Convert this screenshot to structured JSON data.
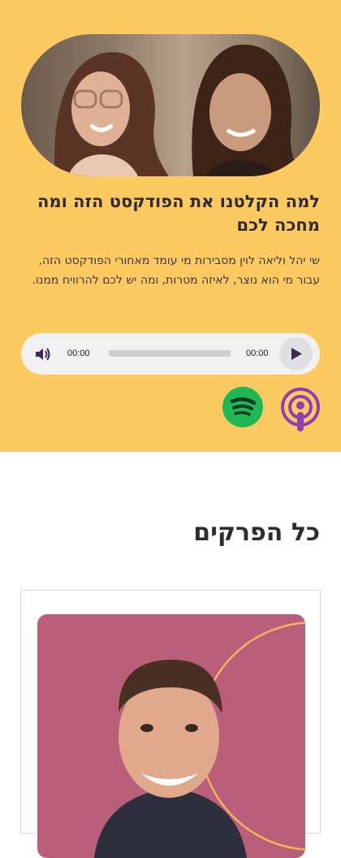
{
  "hero": {
    "title": "למה הקלטנו את הפודקסט הזה ומה מחכה לכם",
    "description": "שי יהל וליאה לוין מסבירות מי עומד מאחורי הפודקסט הזה, עבור מי הוא נוצר, לאיזה מטרות, ומה יש לכם להרוויח ממנו."
  },
  "player": {
    "current_time": "00:00",
    "duration": "00:00",
    "progress": 0
  },
  "platforms": {
    "apple_icon": "apple-podcasts-icon",
    "spotify_icon": "spotify-icon"
  },
  "episodes": {
    "heading": "כל הפרקים"
  },
  "colors": {
    "hero_bg": "#fdca62",
    "card_image_bg": "#b95f7c",
    "podcast_purple": "#8f3fb2",
    "spotify_green": "#1db954"
  }
}
